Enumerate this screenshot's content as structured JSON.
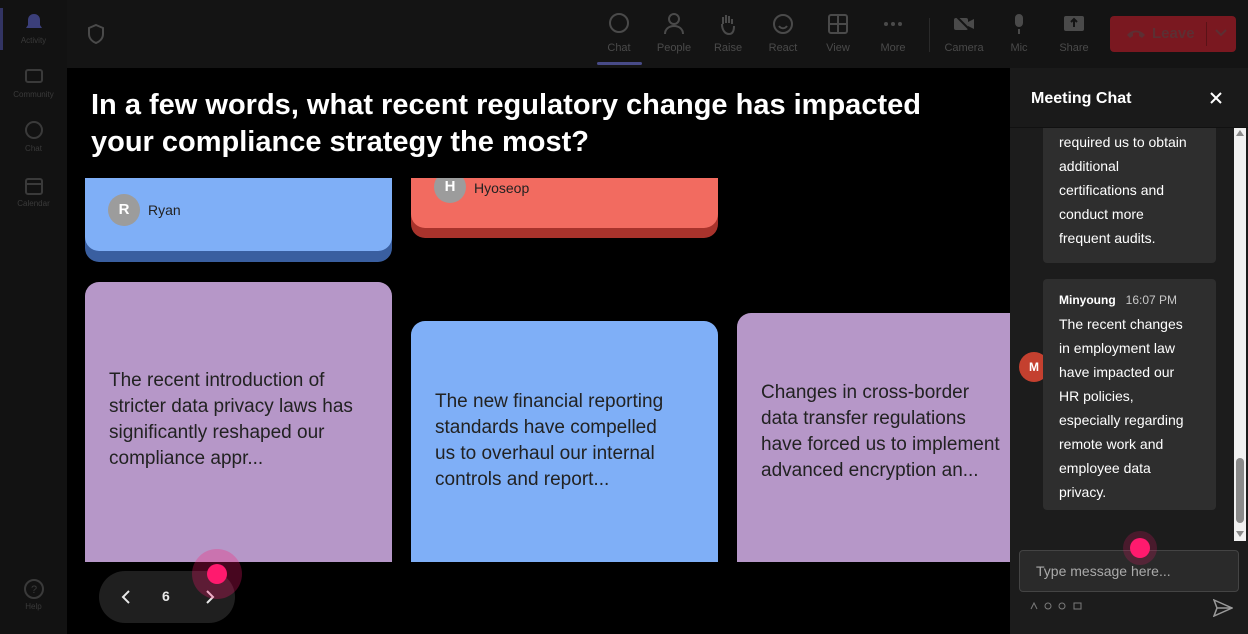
{
  "rail": {
    "items": [
      {
        "label": "Activity"
      },
      {
        "label": "Community"
      },
      {
        "label": "Chat"
      },
      {
        "label": "Calendar"
      },
      {
        "label": "Help"
      }
    ]
  },
  "toolbar": {
    "chat": "Chat",
    "people": "People",
    "raise": "Raise",
    "react": "React",
    "view": "View",
    "more": "More",
    "camera": "Camera",
    "mic": "Mic",
    "share": "Share",
    "leave": "Leave"
  },
  "stage": {
    "question": "In a few words, what recent regulatory change has impacted your compliance strategy the most?",
    "top_cards": [
      {
        "initial": "R",
        "author": "Ryan"
      },
      {
        "initial": "H",
        "author": "Hyoseop"
      }
    ],
    "cards": [
      {
        "text": "The recent introduction of\nstricter data privacy laws has\nsignificantly reshaped our\ncompliance appr..."
      },
      {
        "text": "The new financial reporting\nstandards have compelled\nus to overhaul our internal\ncontrols and report..."
      },
      {
        "text": "Changes in cross-border\ndata transfer regulations\nhave forced us to implement\nadvanced encryption an..."
      }
    ],
    "page": "6"
  },
  "chat": {
    "title": "Meeting Chat",
    "messages": [
      {
        "body": "required us to obtain\nadditional\ncertifications and\nconduct more\nfrequent audits."
      },
      {
        "avatar": "M",
        "author": "Minyoung",
        "time": "16:07 PM",
        "body": "The recent changes\nin employment law\nhave impacted our\nHR policies,\nespecially regarding\nremote work and\nemployee data\nprivacy."
      }
    ],
    "input_placeholder": "Type message here..."
  },
  "colors": {
    "blue_card": "#7faff7",
    "purple_card": "#b697c8",
    "red_card": "#f26b60",
    "accent": "#5b5fc7",
    "leave": "#c4262e",
    "pointer": "#ff1a6e"
  }
}
